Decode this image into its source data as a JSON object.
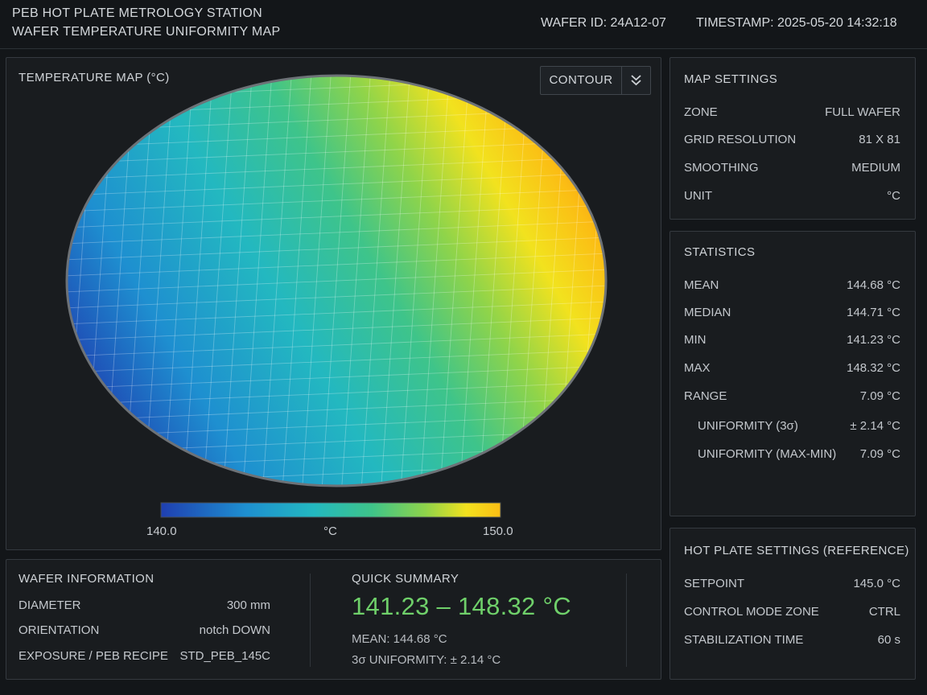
{
  "header": {
    "title_line1": "PEB HOT PLATE METROLOGY STATION",
    "title_line2": "WAFER TEMPERATURE UNIFORMITY MAP",
    "wafer_id": "WAFER ID: 24A12-07",
    "timestamp": "TIMESTAMP: 2025-05-20 14:32:18"
  },
  "map": {
    "title": "TEMPERATURE MAP (°C)",
    "view_mode": "CONTOUR",
    "colorbar": {
      "min_label": "140.0",
      "unit_label": "°C",
      "max_label": "150.0",
      "min": 140.0,
      "max": 150.0
    },
    "colors": [
      "#1f3fb0",
      "#1e8fd0",
      "#23b8c0",
      "#3ec48a",
      "#8fd44a",
      "#f2e21e",
      "#fbbe14",
      "#f58a10"
    ]
  },
  "map_settings": {
    "title": "MAP SETTINGS",
    "rows": [
      {
        "label": "ZONE",
        "value": "FULL WAFER"
      },
      {
        "label": "GRID RESOLUTION",
        "value": "81 X 81"
      },
      {
        "label": "SMOOTHING",
        "value": "MEDIUM"
      },
      {
        "label": "UNIT",
        "value": "°C"
      }
    ]
  },
  "statistics": {
    "title": "STATISTICS",
    "rows": [
      {
        "label": "MEAN",
        "value": "144.68 °C"
      },
      {
        "label": "MEDIAN",
        "value": "144.71 °C"
      },
      {
        "label": "MIN",
        "value": "141.23 °C"
      },
      {
        "label": "MAX",
        "value": "148.32 °C"
      },
      {
        "label": "RANGE",
        "value": "7.09 °C"
      },
      {
        "label": "UNIFORMITY (3σ)",
        "value": "± 2.14 °C"
      },
      {
        "label": "UNIFORMITY (MAX-MIN)",
        "value": "7.09 °C"
      }
    ]
  },
  "hot_plate": {
    "title": "HOT PLATE SETTINGS (REFERENCE)",
    "rows": [
      {
        "label": "SETPOINT",
        "value": "145.0 °C"
      },
      {
        "label": "CONTROL MODE ZONE",
        "value": "CTRL"
      },
      {
        "label": "STABILIZATION TIME",
        "value": "60 s"
      }
    ]
  },
  "wafer_info": {
    "title": "WAFER INFORMATION",
    "rows": [
      {
        "label": "DIAMETER",
        "value": "300 mm"
      },
      {
        "label": "ORIENTATION",
        "value": "notch DOWN"
      },
      {
        "label": "EXPOSURE / PEB RECIPE",
        "value": "STD_PEB_145C"
      }
    ]
  },
  "quick_summary": {
    "title": "QUICK SUMMARY",
    "range": "141.23 – 148.32 °C",
    "mean": "MEAN: 144.68 °C",
    "uniformity": "3σ UNIFORMITY: ± 2.14 °C"
  }
}
